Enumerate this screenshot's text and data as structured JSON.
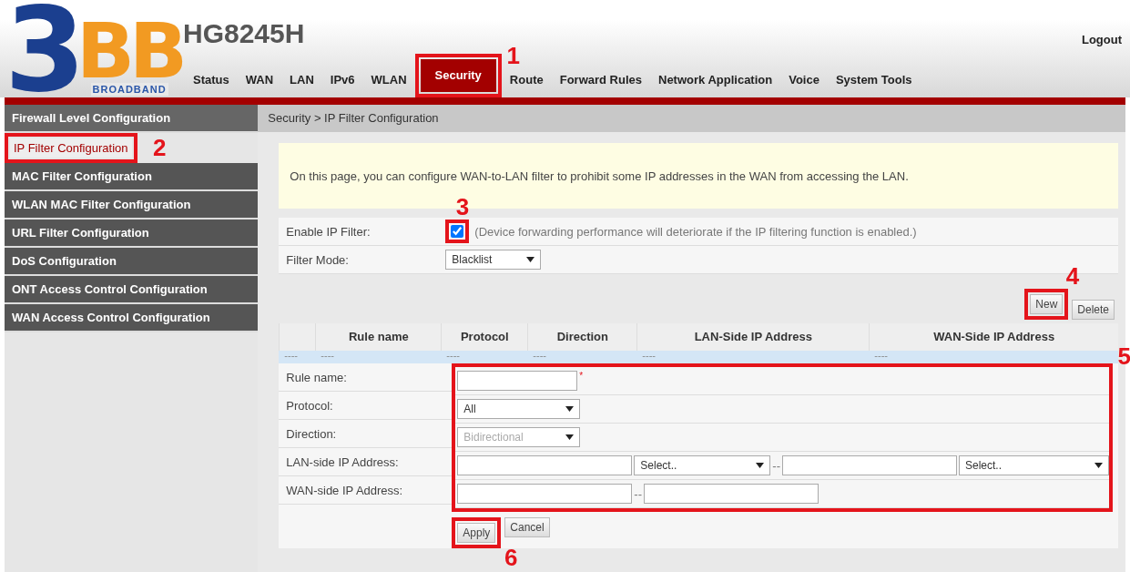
{
  "header": {
    "logo": {
      "numeral": "3",
      "letters": "BB",
      "tagline": "BROADBAND"
    },
    "model": "HG8245H",
    "logout": "Logout"
  },
  "nav": [
    {
      "label": "Status",
      "selected": false
    },
    {
      "label": "WAN",
      "selected": false
    },
    {
      "label": "LAN",
      "selected": false
    },
    {
      "label": "IPv6",
      "selected": false
    },
    {
      "label": "WLAN",
      "selected": false
    },
    {
      "label": "Security",
      "selected": true,
      "annotation": "1"
    },
    {
      "label": "Route",
      "selected": false
    },
    {
      "label": "Forward Rules",
      "selected": false
    },
    {
      "label": "Network Application",
      "selected": false
    },
    {
      "label": "Voice",
      "selected": false
    },
    {
      "label": "System Tools",
      "selected": false
    }
  ],
  "sidebar": {
    "items": [
      {
        "label": "Firewall Level Configuration",
        "selected": false
      },
      {
        "label": "IP Filter Configuration",
        "selected": true,
        "annotation": "2"
      },
      {
        "label": "MAC Filter Configuration",
        "selected": false
      },
      {
        "label": "WLAN MAC Filter Configuration",
        "selected": false
      },
      {
        "label": "URL Filter Configuration",
        "selected": false
      },
      {
        "label": "DoS Configuration",
        "selected": false
      },
      {
        "label": "ONT Access Control Configuration",
        "selected": false
      },
      {
        "label": "WAN Access Control Configuration",
        "selected": false
      }
    ]
  },
  "breadcrumb": "Security > IP Filter Configuration",
  "info": "On this page, you can configure WAN-to-LAN filter to prohibit some IP addresses in the WAN from accessing the LAN.",
  "settings": [
    {
      "kind": "checkbox",
      "label": "Enable IP Filter:",
      "checked": true,
      "note": "(Device forwarding performance will deteriorate if the IP filtering function is enabled.)",
      "annotation": "3"
    },
    {
      "kind": "select",
      "label": "Filter Mode:",
      "value": "Blacklist"
    }
  ],
  "actions": [
    {
      "label": "New",
      "annotation": "4"
    },
    {
      "label": "Delete"
    }
  ],
  "table": {
    "columns": [
      "Rule name",
      "Protocol",
      "Direction",
      "LAN-Side IP Address",
      "WAN-Side IP Address"
    ],
    "rows": [
      [
        "----",
        "----",
        "----",
        "----",
        "----",
        "----"
      ]
    ]
  },
  "form": {
    "annotation": "5",
    "rows": [
      {
        "label": "Rule name:",
        "fields": [
          {
            "kind": "input"
          },
          {
            "kind": "mark",
            "text": "*"
          }
        ]
      },
      {
        "label": "Protocol:",
        "fields": [
          {
            "kind": "select",
            "value": "All",
            "disabled": false
          }
        ]
      },
      {
        "label": "Direction:",
        "fields": [
          {
            "kind": "select",
            "value": "Bidirectional",
            "disabled": true
          }
        ]
      },
      {
        "label": "LAN-side IP Address:",
        "fields": [
          {
            "kind": "input"
          },
          {
            "kind": "select",
            "value": "Select..",
            "disabled": false
          },
          {
            "kind": "sep",
            "text": "--"
          },
          {
            "kind": "input"
          },
          {
            "kind": "select",
            "value": "Select..",
            "disabled": false
          }
        ]
      },
      {
        "label": "WAN-side IP Address:",
        "fields": [
          {
            "kind": "input"
          },
          {
            "kind": "sep",
            "text": "--"
          },
          {
            "kind": "input"
          }
        ]
      }
    ]
  },
  "buttons": [
    {
      "label": "Apply",
      "annotation": "6"
    },
    {
      "label": "Cancel"
    }
  ]
}
